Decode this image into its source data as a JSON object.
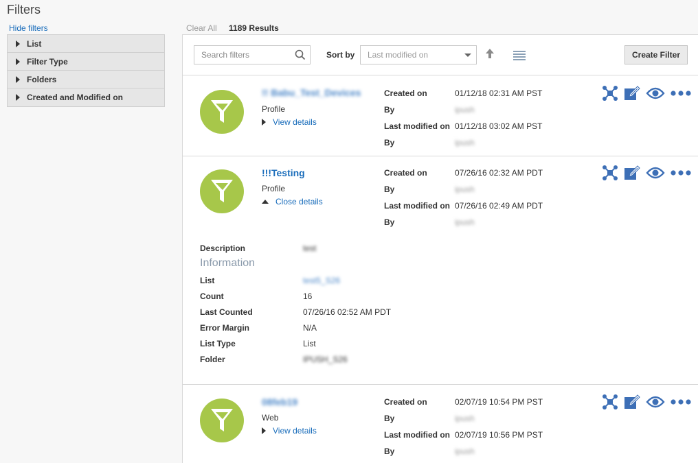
{
  "page": {
    "title": "Filters",
    "hide_filters": "Hide filters"
  },
  "sidebar": {
    "items": [
      {
        "label": "List"
      },
      {
        "label": "Filter Type"
      },
      {
        "label": "Folders"
      },
      {
        "label": "Created and Modified on"
      }
    ]
  },
  "results": {
    "clear_all": "Clear All",
    "count": "1189 Results"
  },
  "toolbar": {
    "search_placeholder": "Search filters",
    "sort_label": "Sort by",
    "sort_value": "Last modified on",
    "create_label": "Create Filter"
  },
  "labels": {
    "created_on": "Created on",
    "by": "By",
    "last_modified_on": "Last modified on",
    "view_details": "View details",
    "close_details": "Close details",
    "description": "Description",
    "information": "Information",
    "list": "List",
    "count": "Count",
    "last_counted": "Last Counted",
    "error_margin": "Error Margin",
    "list_type": "List Type",
    "folder": "Folder"
  },
  "filters": [
    {
      "name": "!! Babu_Test_Devices",
      "type": "Profile",
      "created_on": "01/12/18 02:31 AM PST",
      "created_by": "ipush",
      "modified_on": "01/12/18 03:02 AM PST",
      "modified_by": "ipush"
    },
    {
      "name": "!!!Testing",
      "type": "Profile",
      "created_on": "07/26/16 02:32 AM PDT",
      "created_by": "ipush",
      "modified_on": "07/26/16 02:49 AM PDT",
      "modified_by": "ipush",
      "details": {
        "description": "test",
        "list": "test5_S26",
        "count": "16",
        "last_counted": "07/26/16 02:52 AM PDT",
        "error_margin": "N/A",
        "list_type": "List",
        "folder": "IPUSH_S26"
      }
    },
    {
      "name": "08feb19",
      "type": "Web",
      "created_on": "02/07/19 10:54 PM PST",
      "created_by": "ipush",
      "modified_on": "02/07/19 10:56 PM PST",
      "modified_by": "ipush"
    }
  ],
  "colors": {
    "accent": "#1a6dbb",
    "avatar": "#a7c74a",
    "action_icon": "#3d6fb6"
  },
  "icons": [
    "search-icon",
    "sort-ascending-icon",
    "list-view-icon",
    "funnel-icon",
    "segment-icon",
    "edit-icon",
    "view-icon",
    "more-icon"
  ]
}
